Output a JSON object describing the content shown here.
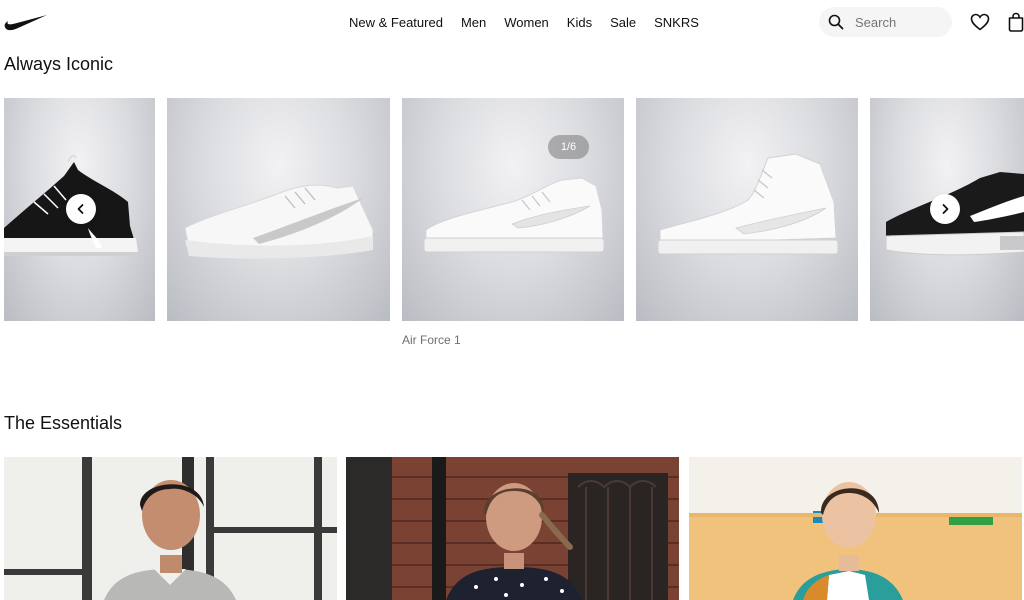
{
  "header": {
    "nav": [
      "New & Featured",
      "Men",
      "Women",
      "Kids",
      "Sale",
      "SNKRS"
    ],
    "search_placeholder": "Search",
    "icons": {
      "logo": "swoosh-logo",
      "search": "search-icon",
      "favorites": "heart-icon",
      "bag": "bag-icon"
    }
  },
  "carousel": {
    "title": "Always Iconic",
    "counter": "1/6",
    "caption": "Air Force 1",
    "prev_icon": "chevron-left-icon",
    "next_icon": "chevron-right-icon"
  },
  "essentials": {
    "title": "The Essentials"
  }
}
